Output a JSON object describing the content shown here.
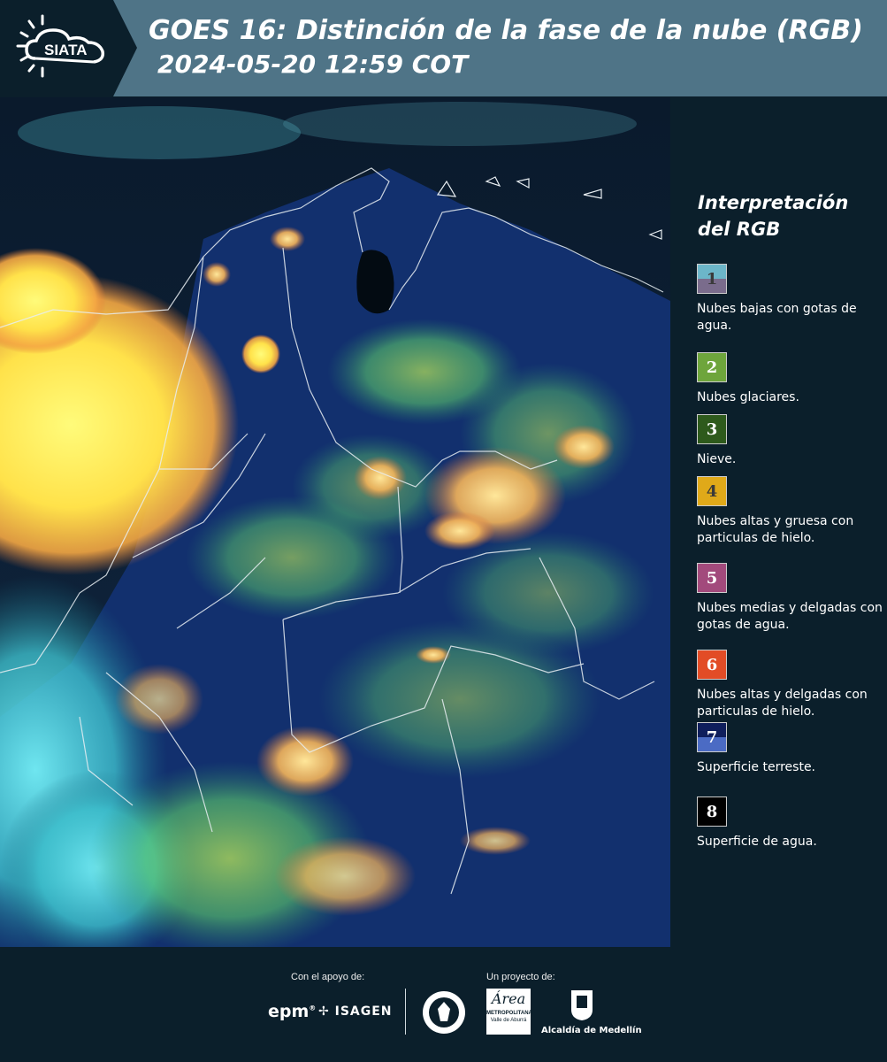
{
  "header": {
    "logo_text": "SIATA",
    "title": "GOES 16: Distinción de la fase de la nube (RGB)",
    "timestamp": "2024-05-20 12:59 COT"
  },
  "legend": {
    "title": "Interpretación del RGB",
    "items": [
      {
        "number": "1",
        "description": "Nubes bajas con gotas de agua.",
        "color_top": "#6cb6c9",
        "color_bottom": "#7a6c8c",
        "number_color": "#3a3a3a"
      },
      {
        "number": "2",
        "description": "Nubes glaciares.",
        "color_top": "#6ea53c",
        "color_bottom": "#6ea53c",
        "number_color": "#ffffff"
      },
      {
        "number": "3",
        "description": "Nieve.",
        "color_top": "#2e5a1c",
        "color_bottom": "#2e5a1c",
        "number_color": "#ffffff"
      },
      {
        "number": "4",
        "description": "Nubes altas y gruesa con particulas de hielo.",
        "color_top": "#e0a919",
        "color_bottom": "#e0a919",
        "number_color": "#3a3a3a"
      },
      {
        "number": "5",
        "description": "Nubes medias y delgadas con gotas de agua.",
        "color_top": "#a24a7c",
        "color_bottom": "#a24a7c",
        "number_color": "#ffffff"
      },
      {
        "number": "6",
        "description": "Nubes altas y delgadas con particulas de hielo.",
        "color_top": "#e24c26",
        "color_bottom": "#e24c26",
        "number_color": "#ffffff"
      },
      {
        "number": "7",
        "description": "Superficie terreste.",
        "color_top": "#0f1e5c",
        "color_bottom": "#4b6bc4",
        "number_color": "#ffffff"
      },
      {
        "number": "8",
        "description": "Superficie de agua.",
        "color_top": "#000000",
        "color_bottom": "#000000",
        "number_color": "#ffffff"
      }
    ]
  },
  "footer": {
    "support_label": "Con el apoyo de:",
    "project_label": "Un proyecto de:",
    "sponsor_epm": "epm",
    "sponsor_isagen": "ISAGEN",
    "partner_area": "Área",
    "partner_area_sub": "METROPOLITANA",
    "partner_area_sub2": "Valle de Aburrá",
    "partner_alcaldia": "Alcaldía de Medellín"
  }
}
